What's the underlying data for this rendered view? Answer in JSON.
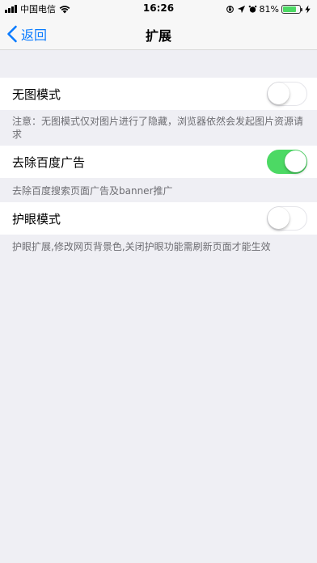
{
  "status_bar": {
    "carrier": "中国电信",
    "time": "16:26",
    "battery_percent": "81%",
    "battery_level": 0.81
  },
  "nav": {
    "back_label": "返回",
    "title": "扩展"
  },
  "settings": [
    {
      "label": "无图模式",
      "enabled": false,
      "note": "注意：无图模式仅对图片进行了隐藏，浏览器依然会发起图片资源请求"
    },
    {
      "label": "去除百度广告",
      "enabled": true,
      "note": "去除百度搜索页面广告及banner推广"
    },
    {
      "label": "护眼模式",
      "enabled": false,
      "note": "护眼扩展,修改网页背景色,关闭护眼功能需刷新页面才能生效"
    }
  ],
  "colors": {
    "accent": "#0a7bff",
    "toggle_on": "#4cd964",
    "background": "#efeff4"
  }
}
